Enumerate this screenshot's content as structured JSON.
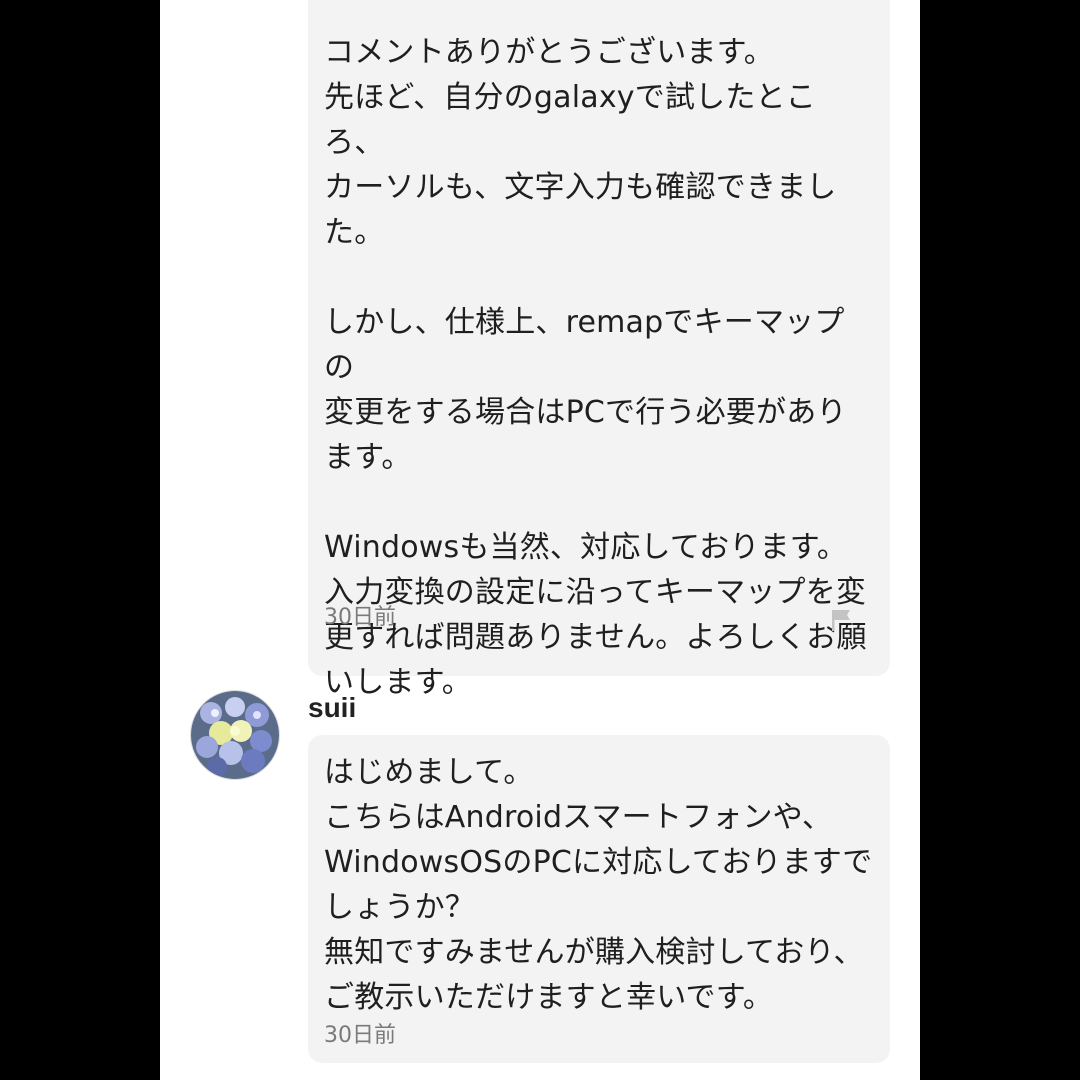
{
  "thread": {
    "reply": {
      "text": "コメントありがとうございます。\n先ほど、自分のgalaxyで試したところ、\nカーソルも、文字入力も確認できまし\nた。\n\nしかし、仕様上、remapでキーマップの\n変更をする場合はPCで行う必要があり\nます。\n\nWindowsも当然、対応しております。\n入力変換の設定に沿ってキーマップを変\n更すれば問題ありません。よろしくお願\nいします。",
      "time": "30日前",
      "flag_icon": "flag-icon"
    },
    "comment": {
      "username": "suii",
      "avatar_icon": "flower-avatar",
      "text": "はじめまして。\nこちらはAndroidスマートフォンや、\nWindowsOSのPCに対応しておりますで\nしょうか？\n無知ですみませんが購入検討しており、\nご教示いただけますと幸いです。",
      "time": "30日前"
    }
  },
  "colors": {
    "background": "#000000",
    "page": "#ffffff",
    "bubble": "#f3f3f3",
    "text": "#1f1f1f",
    "meta": "#7a7a7a"
  }
}
